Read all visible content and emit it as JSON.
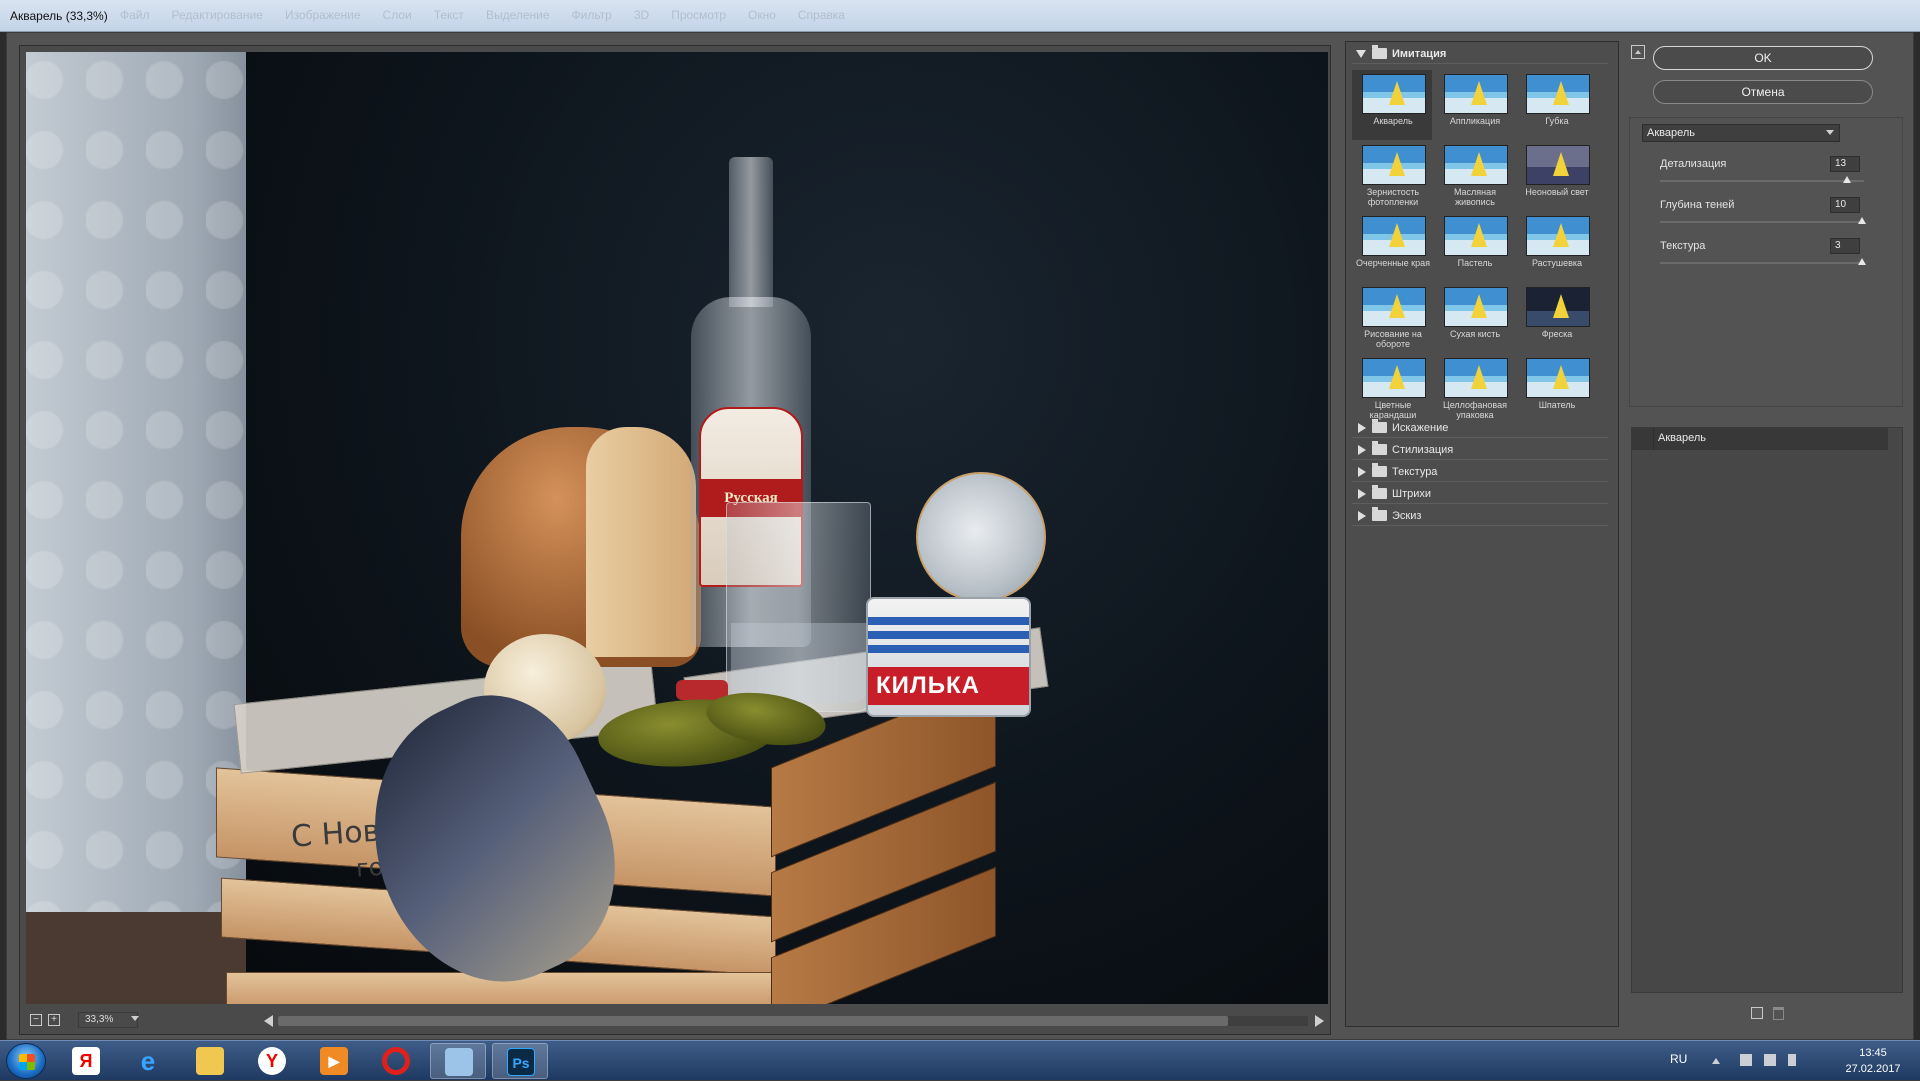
{
  "window": {
    "title": "Акварель (33,3%)",
    "ghost_menu": [
      "Файл",
      "Редактирование",
      "Изображение",
      "Слои",
      "Текст",
      "Выделение",
      "Фильтр",
      "3D",
      "Просмотр",
      "Окно",
      "Справка"
    ]
  },
  "preview": {
    "zoom_value": "33,3%",
    "crate_text_1": "С Новым 2017",
    "crate_text_2": "годом",
    "label_text": "Русская",
    "can_text": "КИЛЬКА"
  },
  "gallery": {
    "open_category": "Имитация",
    "filters": [
      {
        "name": "Акварель",
        "selected": true
      },
      {
        "name": "Аппликация"
      },
      {
        "name": "Губка"
      },
      {
        "name": "Зернистость фотопленки"
      },
      {
        "name": "Масляная живопись"
      },
      {
        "name": "Неоновый свет"
      },
      {
        "name": "Очерченные края"
      },
      {
        "name": "Пастель"
      },
      {
        "name": "Растушевка"
      },
      {
        "name": "Рисование на обороте"
      },
      {
        "name": "Сухая кисть"
      },
      {
        "name": "Фреска"
      },
      {
        "name": "Цветные карандаши"
      },
      {
        "name": "Целлофановая упаковка"
      },
      {
        "name": "Шпатель"
      }
    ],
    "closed_categories": [
      "Искажение",
      "Стилизация",
      "Текстура",
      "Штрихи",
      "Эскиз"
    ]
  },
  "settings": {
    "ok_label": "OK",
    "cancel_label": "Отмена",
    "filter_select": "Акварель",
    "params": [
      {
        "label": "Детализация",
        "value": "13",
        "max": 14
      },
      {
        "label": "Глубина теней",
        "value": "10",
        "max": 10
      },
      {
        "label": "Текстура",
        "value": "3",
        "max": 3
      }
    ],
    "layer_name": "Акварель"
  },
  "taskbar": {
    "apps": [
      "yandex",
      "internet-explorer",
      "file-explorer",
      "yandex-browser",
      "media-player",
      "opera",
      "photo-viewer",
      "photoshop"
    ],
    "lang": "RU",
    "time": "13:45",
    "date": "27.02.2017"
  },
  "colors": {
    "dialog_bg": "#535353",
    "taskbar": "#1f3a62",
    "can_red": "#c81e2a"
  }
}
